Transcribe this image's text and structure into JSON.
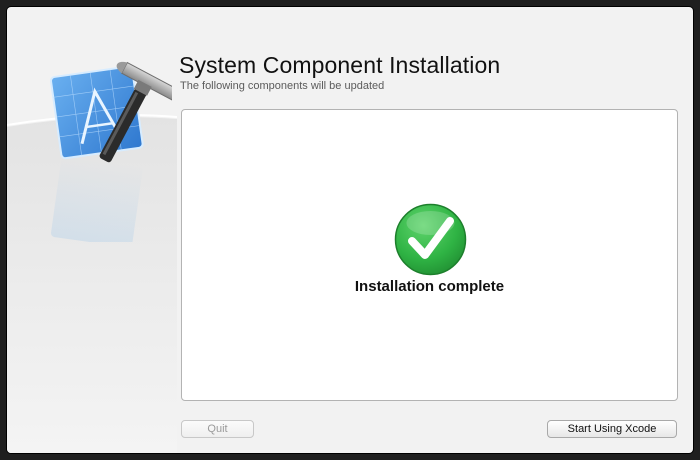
{
  "window": {
    "title": "System Component Installation",
    "subtitle": "The following components will be updated"
  },
  "status": {
    "message": "Installation complete",
    "icon": "checkmark-icon",
    "accent_color": "#2fb344"
  },
  "buttons": {
    "quit_label": "Quit",
    "quit_enabled": false,
    "start_label": "Start Using Xcode",
    "start_enabled": true
  },
  "app_icon": "xcode-hammer-blueprint-icon"
}
